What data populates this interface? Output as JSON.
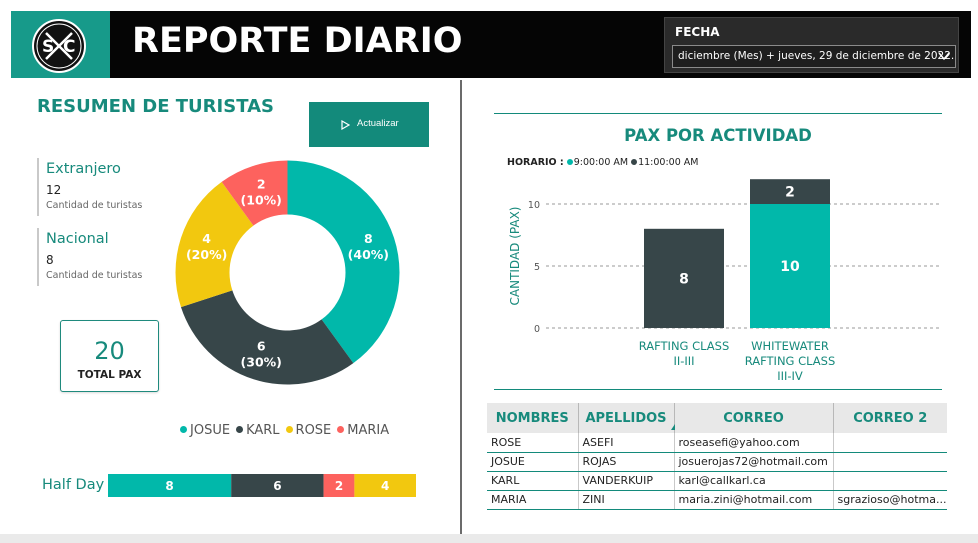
{
  "header": {
    "title": "REPORTE DIARIO",
    "logo_text": "S C",
    "date_filter": {
      "label": "FECHA",
      "value": "diciembre (Mes) + jueves, 29 de diciembre de 2022..."
    }
  },
  "summary": {
    "title": "RESUMEN DE TURISTAS",
    "refresh_button": "Actualizar",
    "cards": [
      {
        "title": "Extranjero",
        "value": "12",
        "subtitle": "Cantidad de turistas"
      },
      {
        "title": "Nacional",
        "value": "8",
        "subtitle": "Cantidad de turistas"
      }
    ],
    "kpi": {
      "value": "20",
      "label": "TOTAL PAX"
    },
    "legend": [
      {
        "name": "JOSUE",
        "color": "#01b8aa"
      },
      {
        "name": "KARL",
        "color": "#374649"
      },
      {
        "name": "ROSE",
        "color": "#f2c80f"
      },
      {
        "name": "MARIA",
        "color": "#fd625e"
      }
    ],
    "half_day": {
      "label": "Half Day"
    }
  },
  "activity": {
    "title": "PAX POR ACTIVIDAD",
    "legend_title": "HORARIO :",
    "legend": [
      {
        "name": "9:00:00 AM",
        "color": "#01b8aa"
      },
      {
        "name": "11:00:00 AM",
        "color": "#374649"
      }
    ]
  },
  "chart_data": [
    {
      "type": "pie",
      "variant": "donut",
      "categories": [
        "JOSUE",
        "KARL",
        "ROSE",
        "MARIA"
      ],
      "values": [
        8,
        6,
        4,
        2
      ],
      "percent_labels": [
        "(40%)",
        "(30%)",
        "(20%)",
        "(10%)"
      ],
      "colors": [
        "#01b8aa",
        "#374649",
        "#f2c80f",
        "#fd625e"
      ],
      "legend_position": "bottom"
    },
    {
      "type": "bar",
      "orientation": "horizontal",
      "stacked": true,
      "categories": [
        "Half Day"
      ],
      "series": [
        {
          "name": "JOSUE",
          "values": [
            8
          ],
          "color": "#01b8aa"
        },
        {
          "name": "KARL",
          "values": [
            6
          ],
          "color": "#374649"
        },
        {
          "name": "MARIA",
          "values": [
            2
          ],
          "color": "#fd625e"
        },
        {
          "name": "ROSE",
          "values": [
            4
          ],
          "color": "#f2c80f"
        }
      ]
    },
    {
      "type": "bar",
      "stacked": true,
      "title": "PAX POR ACTIVIDAD",
      "ylabel": "CANTIDAD (PAX)",
      "categories": [
        "RAFTING CLASS II-III",
        "WHITEWATER RAFTING CLASS III-IV"
      ],
      "category_lines": [
        [
          "RAFTING CLASS",
          "II-III"
        ],
        [
          "WHITEWATER",
          "RAFTING CLASS",
          "III-IV"
        ]
      ],
      "series": [
        {
          "name": "9:00:00 AM",
          "values": [
            0,
            10
          ],
          "color": "#01b8aa"
        },
        {
          "name": "11:00:00 AM",
          "values": [
            8,
            2
          ],
          "color": "#374649"
        }
      ],
      "yticks": [
        0,
        5,
        10
      ],
      "ylim": [
        0,
        12
      ],
      "grid": true,
      "legend_position": "top-left"
    }
  ],
  "table": {
    "headers": [
      "NOMBRES",
      "APELLIDOS",
      "CORREO",
      "CORREO 2"
    ],
    "rows": [
      [
        "ROSE",
        "ASEFI",
        "roseasefi@yahoo.com",
        ""
      ],
      [
        "JOSUE",
        "ROJAS",
        "josuerojas72@hotmail.com",
        ""
      ],
      [
        "KARL",
        "VANDERKUIP",
        "karl@callkarl.ca",
        ""
      ],
      [
        "MARIA",
        "ZINI",
        "maria.zini@hotmail.com",
        "sgrazioso@hotma..."
      ]
    ]
  }
}
